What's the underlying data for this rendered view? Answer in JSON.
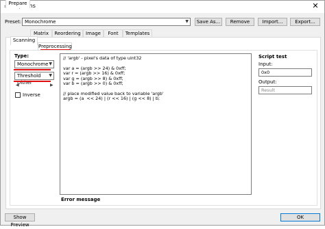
{
  "window": {
    "title": "Options",
    "close_glyph": "✕"
  },
  "preset": {
    "label": "Preset:",
    "value": "Monochrome"
  },
  "toolbar": {
    "save_as": "Save As...",
    "remove": "Remove",
    "import": "Import...",
    "export": "Export..."
  },
  "tabs": [
    "Prepare",
    "Matrix",
    "Reordering",
    "Image",
    "Font",
    "Templates"
  ],
  "subtabs": [
    "Scanning",
    "Preprocessing"
  ],
  "type_group": {
    "label": "Type:",
    "mode": "Monochrome",
    "dither": "Threshold Dither",
    "inverse_label": "Inverse"
  },
  "script": {
    "lines": [
      "// 'argb' - pixel's data of type uint32",
      "",
      "var a = (argb >> 24) & 0xff;",
      "var r = (argb >> 16) & 0xff;",
      "var g = (argb >> 8) & 0xff;",
      "var b = (argb >> 0) & 0xff;",
      "",
      "// place modified value back to variable 'argb'",
      "argb = (a  << 24) | (r << 16) | (g << 8) | b;"
    ],
    "error_label": "Error message"
  },
  "script_test": {
    "title": "Script test",
    "input_label": "Input:",
    "input_value": "0x0",
    "output_label": "Output:",
    "output_placeholder": "Result"
  },
  "footer": {
    "show_preview": "Show Preview",
    "ok": "OK"
  },
  "colors": {
    "highlight": "#e01010",
    "panel": "#ffffff",
    "window": "#f0f0f0"
  }
}
